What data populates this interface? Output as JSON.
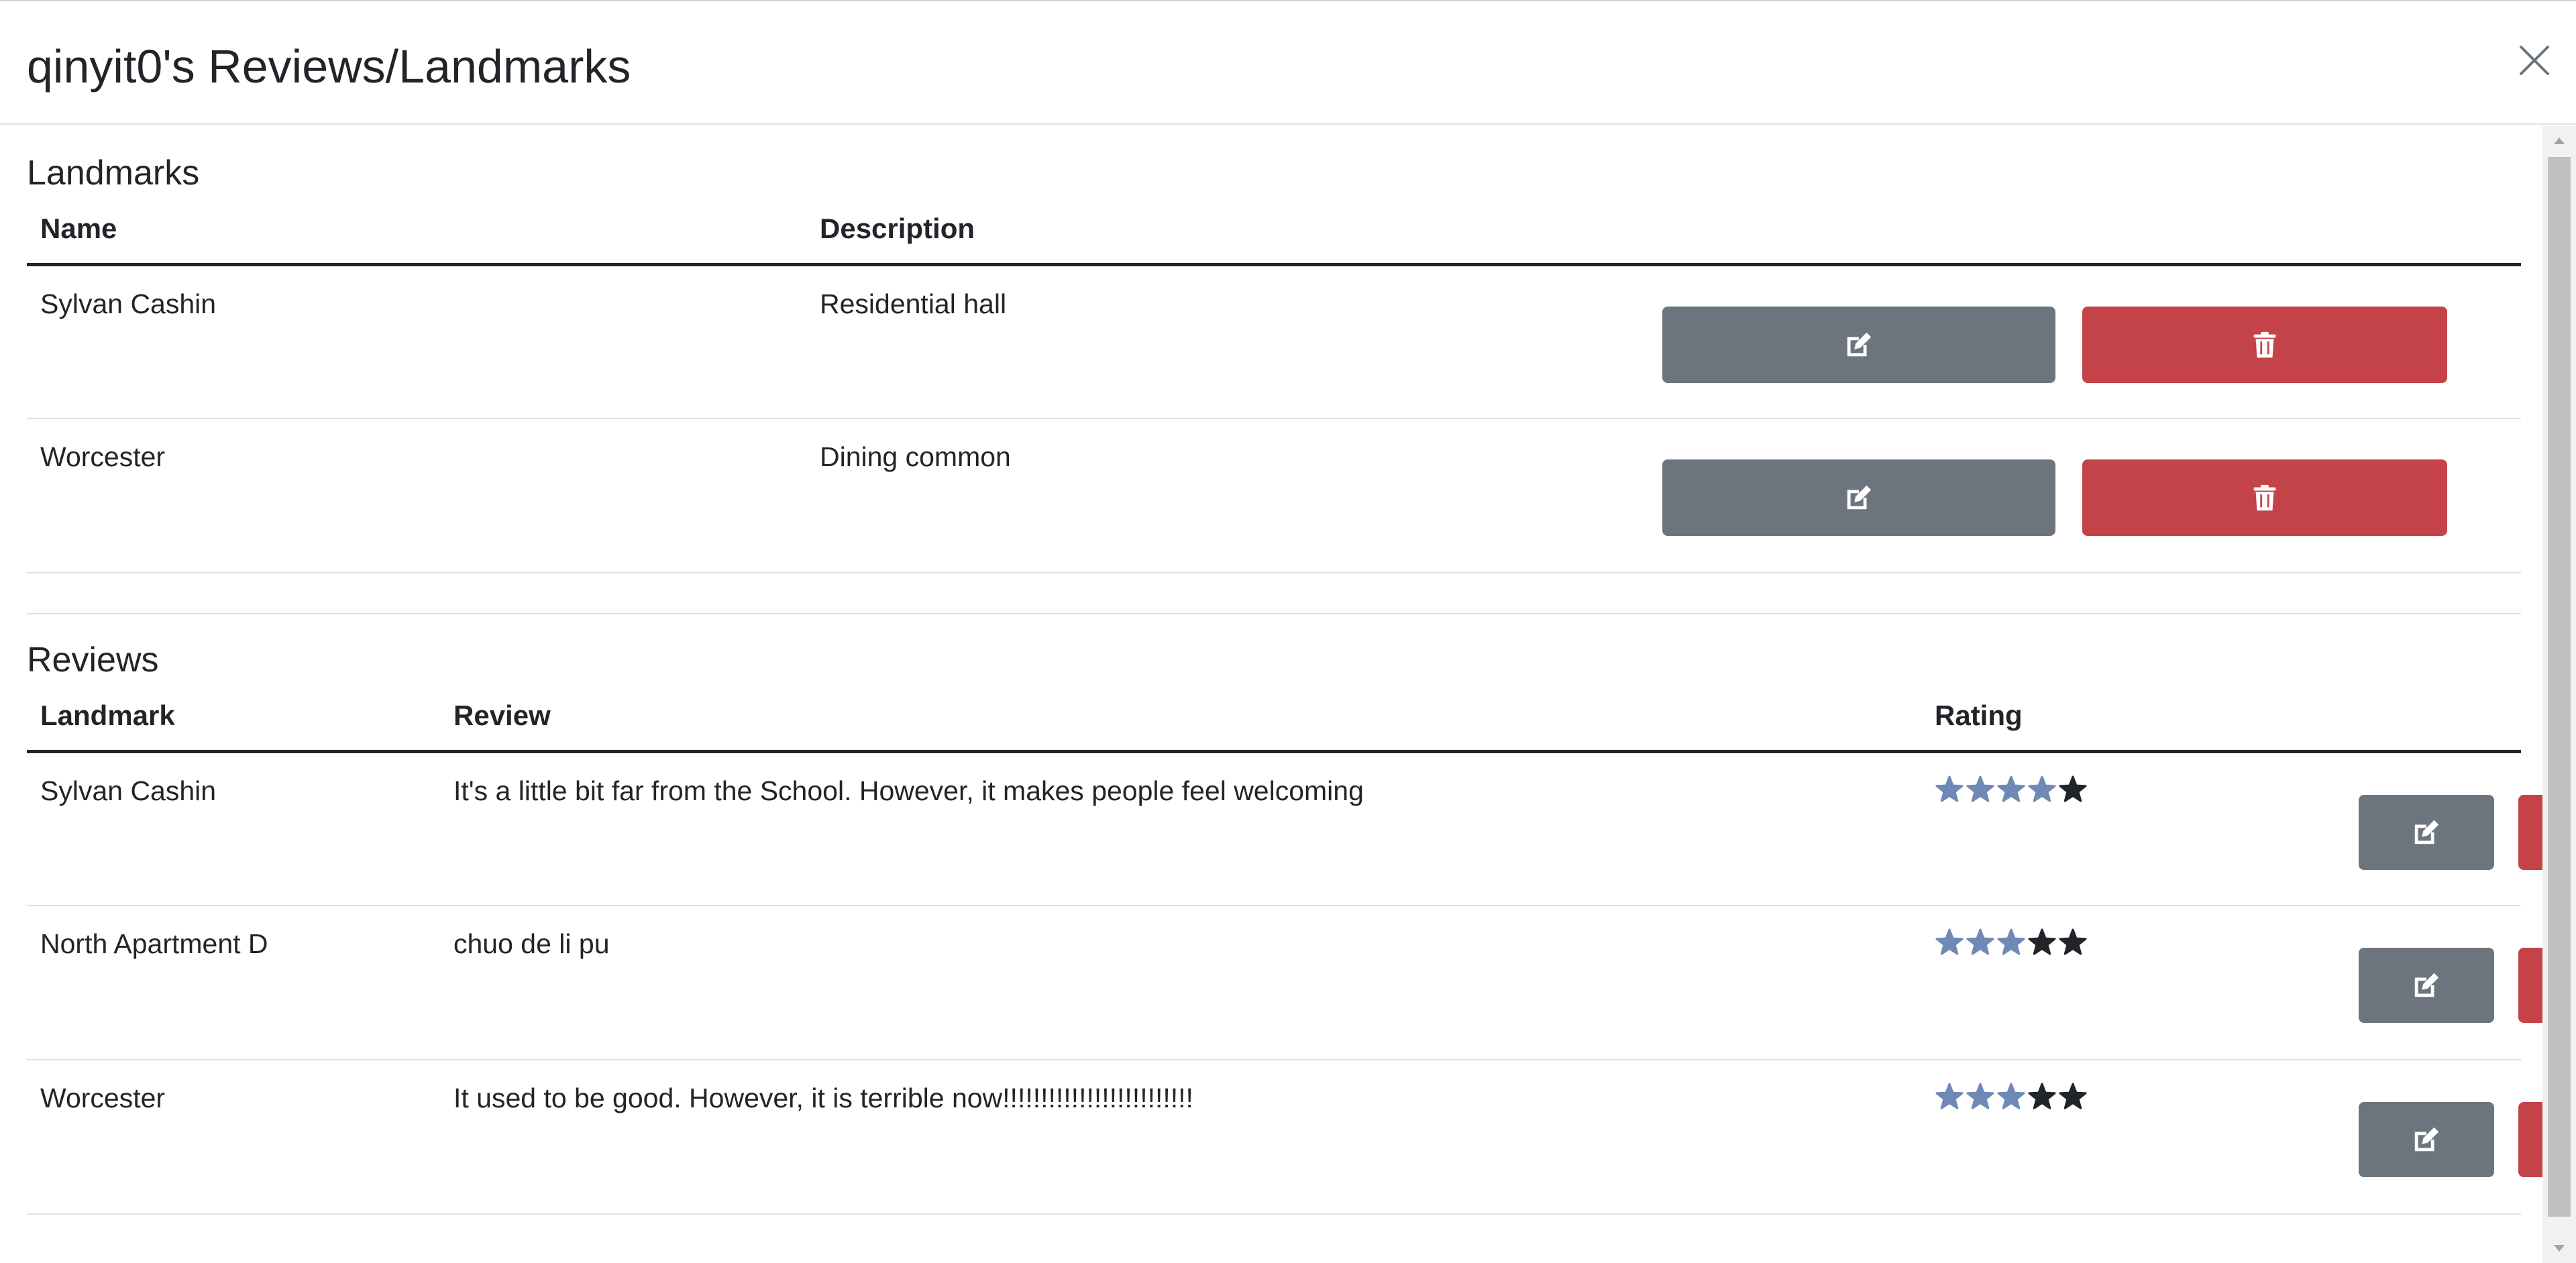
{
  "modal": {
    "title": "qinyit0's Reviews/Landmarks"
  },
  "landmarks": {
    "heading": "Landmarks",
    "columns": {
      "name": "Name",
      "description": "Description"
    },
    "rows": [
      {
        "name": "Sylvan Cashin",
        "description": "Residential hall"
      },
      {
        "name": "Worcester",
        "description": "Dining common"
      }
    ]
  },
  "reviews": {
    "heading": "Reviews",
    "columns": {
      "landmark": "Landmark",
      "review": "Review",
      "rating": "Rating"
    },
    "rows": [
      {
        "landmark": "Sylvan Cashin",
        "review": "It's a little bit far from the School. However, it makes people feel welcoming",
        "rating": 4,
        "max_rating": 5
      },
      {
        "landmark": "North Apartment D",
        "review": "chuo de li pu",
        "rating": 3,
        "max_rating": 5
      },
      {
        "landmark": "Worcester",
        "review": "It used to be good. However, it is terrible now!!!!!!!!!!!!!!!!!!!!!!!!!",
        "rating": 3,
        "max_rating": 5
      }
    ]
  },
  "icons": {
    "close": "close-icon",
    "edit": "edit-icon",
    "delete": "trash-icon",
    "star": "star-icon"
  },
  "colors": {
    "star_filled": "#6f89b7",
    "star_empty": "#212529",
    "edit_button": "#6c757d",
    "delete_button": "#c44349"
  }
}
